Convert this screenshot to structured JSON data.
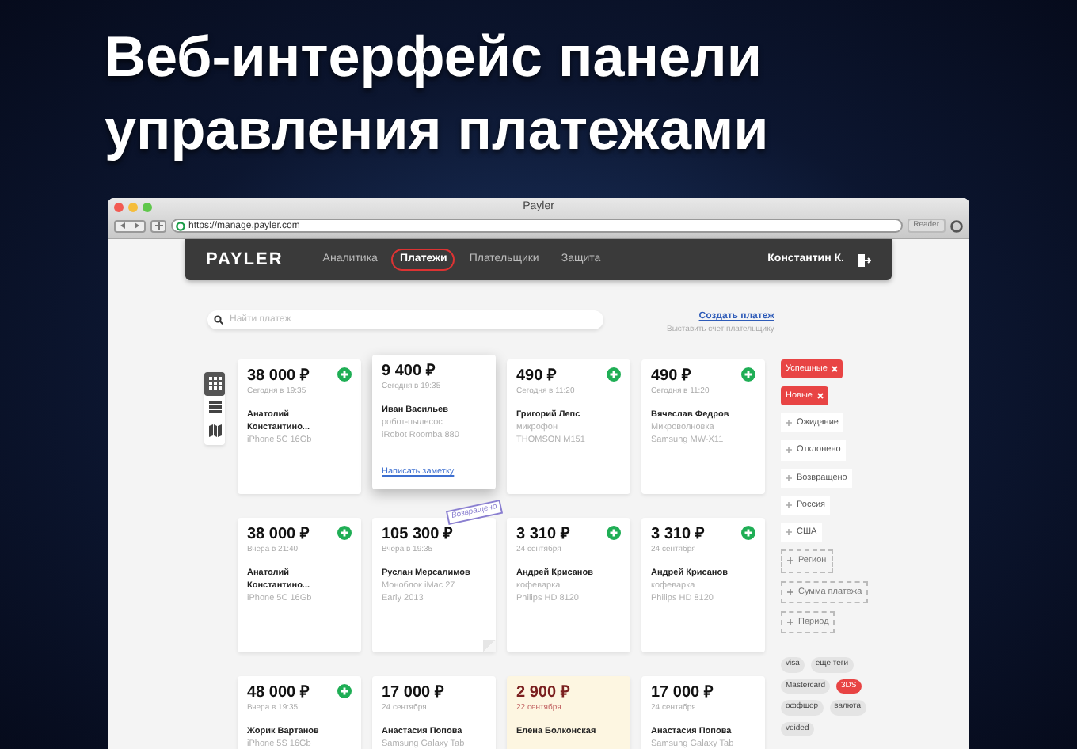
{
  "headline": [
    "Веб-интерфейс панели",
    "управления платежами"
  ],
  "window": {
    "title": "Payler",
    "url": "https://manage.payler.com",
    "reader": "Reader"
  },
  "nav": {
    "logo": "PAYLER",
    "user": "Константин К."
  },
  "tabs": [
    {
      "label": "Аналитика",
      "selected": false
    },
    {
      "label": "Платежи",
      "selected": true
    },
    {
      "label": "Плательщики",
      "selected": false
    },
    {
      "label": "Защита",
      "selected": false
    }
  ],
  "search": {
    "placeholder": "Найти платеж"
  },
  "create_link": "Создать платеж",
  "create_hint": "Выставить счет плательщику",
  "view_modes": [
    {
      "kind": "grid",
      "selected": true
    },
    {
      "kind": "list",
      "selected": false
    },
    {
      "kind": "map",
      "selected": false
    }
  ],
  "payments": [
    {
      "amount": "38 000 ₽",
      "date": "Сегодня в 19:35",
      "name": "Анатолий Константино...",
      "details": [
        "iPhone 5C 16Gb"
      ],
      "add": true,
      "raised": false,
      "pending": false
    },
    {
      "amount": "9 400 ₽",
      "date": "Сегодня в 19:35",
      "name": "Иван Васильев",
      "details": [
        "робот-пылесос",
        "iRobot Roomba 880"
      ],
      "note_link": "Написать заметку",
      "add": false,
      "raised": true,
      "pending": false
    },
    {
      "amount": "490 ₽",
      "date": "Сегодня в 11:20",
      "name": "Григорий Лепс",
      "details": [
        "микрофон",
        "THOMSON M151"
      ],
      "add": true,
      "raised": false,
      "pending": false
    },
    {
      "amount": "490 ₽",
      "date": "Сегодня в 11:20",
      "name": "Вячеслав Федров",
      "details": [
        "Микроволновка",
        "Samsung MW-X11"
      ],
      "add": true,
      "raised": false,
      "pending": false
    },
    {
      "amount": "38 000 ₽",
      "date": "Вчера в 21:40",
      "name": "Анатолий Константино...",
      "details": [
        "iPhone 5C 16Gb"
      ],
      "add": true,
      "raised": false,
      "pending": false
    },
    {
      "amount": "105 300 ₽",
      "date": "Вчера в 19:35",
      "name": "Руслан Мерсалимов",
      "details": [
        "Моноблок iMac 27",
        "Early 2013"
      ],
      "stamp": "Возвращено",
      "add": false,
      "raised": false,
      "pending": false
    },
    {
      "amount": "3 310 ₽",
      "date": "24 сентября",
      "name": "Андрей Крисанов",
      "details": [
        "кофеварка",
        "Philips HD 8120"
      ],
      "add": true,
      "raised": false,
      "pending": false
    },
    {
      "amount": "3 310 ₽",
      "date": "24 сентября",
      "name": "Андрей Крисанов",
      "details": [
        "кофеварка",
        "Philips HD 8120"
      ],
      "add": true,
      "raised": false,
      "pending": false
    },
    {
      "amount": "48 000 ₽",
      "date": "Вчера в 19:35",
      "name": "Жорик Вартанов",
      "details": [
        "iPhone 5S 16Gb"
      ],
      "add": true,
      "raised": false,
      "pending": false
    },
    {
      "amount": "17 000 ₽",
      "date": "24 сентября",
      "name": "Анастасия Попова",
      "details": [
        "Samsung Galaxy Tab"
      ],
      "add": false,
      "raised": false,
      "pending": false
    },
    {
      "amount": "2 900 ₽",
      "date": "22 сентября",
      "name": "Елена Болконская",
      "add": false,
      "raised": false,
      "pending": true
    },
    {
      "amount": "17 000 ₽",
      "date": "24 сентября",
      "name": "Анастасия Попова",
      "details": [
        "Samsung Galaxy Tab"
      ],
      "add": false,
      "raised": false,
      "pending": false
    }
  ],
  "filters": {
    "active": [
      "Успешные",
      "Новые"
    ],
    "options": [
      "Ожидание",
      "Отклонено",
      "Возвращено",
      "Россия",
      "США"
    ],
    "add": [
      "Регион",
      "Сумма платежа",
      "Период"
    ]
  },
  "tags": [
    {
      "label": "visa",
      "highlighted": false
    },
    {
      "label": "еще теги",
      "highlighted": false
    },
    {
      "label": "Mastercard",
      "highlighted": false
    },
    {
      "label": "3DS",
      "highlighted": true
    },
    {
      "label": "оффшор",
      "highlighted": false
    },
    {
      "label": "валюта",
      "highlighted": false
    },
    {
      "label": "voided",
      "highlighted": false
    }
  ]
}
